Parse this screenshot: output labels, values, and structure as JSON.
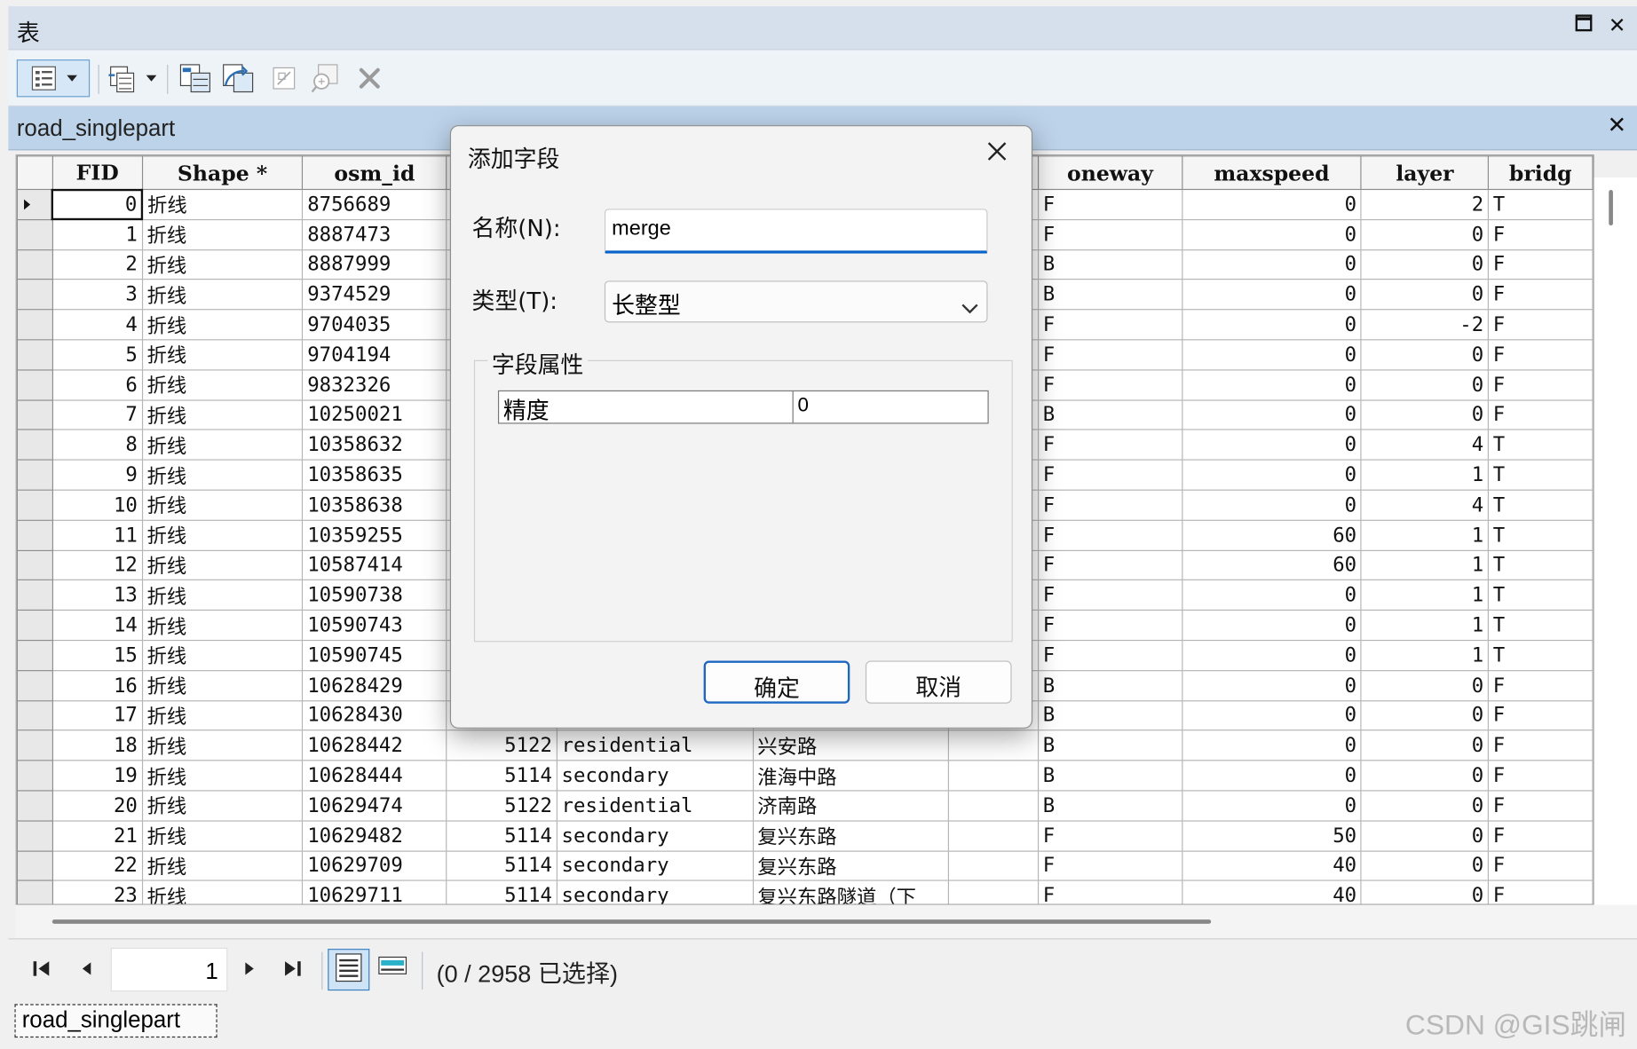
{
  "window": {
    "title": "表"
  },
  "table_tab": {
    "name": "road_singlepart"
  },
  "columns": [
    "FID",
    "Shape *",
    "osm_id",
    "",
    "",
    "",
    "",
    "oneway",
    "maxspeed",
    "layer",
    "bridg"
  ],
  "rows": [
    [
      "0",
      "折线",
      "8756689",
      "",
      "",
      "",
      "",
      "F",
      "0",
      "2",
      "T"
    ],
    [
      "1",
      "折线",
      "8887473",
      "",
      "",
      "",
      "",
      "F",
      "0",
      "0",
      "F"
    ],
    [
      "2",
      "折线",
      "8887999",
      "",
      "",
      "",
      "",
      "B",
      "0",
      "0",
      "F"
    ],
    [
      "3",
      "折线",
      "9374529",
      "",
      "",
      "",
      "",
      "B",
      "0",
      "0",
      "F"
    ],
    [
      "4",
      "折线",
      "9704035",
      "",
      "",
      "",
      "",
      "F",
      "0",
      "-2",
      "F"
    ],
    [
      "5",
      "折线",
      "9704194",
      "",
      "",
      "",
      "",
      "F",
      "0",
      "0",
      "F"
    ],
    [
      "6",
      "折线",
      "9832326",
      "",
      "",
      "",
      "",
      "F",
      "0",
      "0",
      "F"
    ],
    [
      "7",
      "折线",
      "10250021",
      "",
      "",
      "",
      "",
      "B",
      "0",
      "0",
      "F"
    ],
    [
      "8",
      "折线",
      "10358632",
      "",
      "",
      "",
      "",
      "F",
      "0",
      "4",
      "T"
    ],
    [
      "9",
      "折线",
      "10358635",
      "",
      "",
      "",
      "",
      "F",
      "0",
      "1",
      "T"
    ],
    [
      "10",
      "折线",
      "10358638",
      "",
      "",
      "",
      "",
      "F",
      "0",
      "4",
      "T"
    ],
    [
      "11",
      "折线",
      "10359255",
      "",
      "",
      "",
      "",
      "F",
      "60",
      "1",
      "T"
    ],
    [
      "12",
      "折线",
      "10587414",
      "",
      "",
      "",
      "",
      "F",
      "60",
      "1",
      "T"
    ],
    [
      "13",
      "折线",
      "10590738",
      "",
      "",
      "",
      "",
      "F",
      "0",
      "1",
      "T"
    ],
    [
      "14",
      "折线",
      "10590743",
      "",
      "",
      "",
      "",
      "F",
      "0",
      "1",
      "T"
    ],
    [
      "15",
      "折线",
      "10590745",
      "",
      "",
      "",
      "",
      "F",
      "0",
      "1",
      "T"
    ],
    [
      "16",
      "折线",
      "10628429",
      "",
      "",
      "",
      "",
      "B",
      "0",
      "0",
      "F"
    ],
    [
      "17",
      "折线",
      "10628430",
      "",
      "",
      "",
      "",
      "B",
      "0",
      "0",
      "F"
    ],
    [
      "18",
      "折线",
      "10628442",
      "5122",
      "residential",
      "兴安路",
      "",
      "B",
      "0",
      "0",
      "F"
    ],
    [
      "19",
      "折线",
      "10628444",
      "5114",
      "secondary",
      "淮海中路",
      "",
      "B",
      "0",
      "0",
      "F"
    ],
    [
      "20",
      "折线",
      "10629474",
      "5122",
      "residential",
      "济南路",
      "",
      "B",
      "0",
      "0",
      "F"
    ],
    [
      "21",
      "折线",
      "10629482",
      "5114",
      "secondary",
      "复兴东路",
      "",
      "F",
      "50",
      "0",
      "F"
    ],
    [
      "22",
      "折线",
      "10629709",
      "5114",
      "secondary",
      "复兴东路",
      "",
      "F",
      "40",
      "0",
      "F"
    ],
    [
      "23",
      "折线",
      "10629711",
      "5114",
      "secondary",
      "复兴东路隧道（下",
      "",
      "F",
      "40",
      "0",
      "F"
    ]
  ],
  "navigation": {
    "page": "1",
    "status": "(0 / 2958 已选择)"
  },
  "bottom_tab": {
    "label": "road_singlepart"
  },
  "watermark": "CSDN @GIS跳闸",
  "dialog": {
    "title": "添加字段",
    "name_label": "名称(N):",
    "name_value": "merge",
    "type_label": "类型(T):",
    "type_value": "长整型",
    "group_title": "字段属性",
    "property_name": "精度",
    "property_value": "0",
    "ok_label": "确定",
    "cancel_label": "取消"
  },
  "icons": [
    "table-options-icon",
    "dropdown-arrow-icon",
    "related-tables-icon",
    "select-by-attributes-icon",
    "switch-selection-icon",
    "clear-selection-icon",
    "zoom-to-selected-icon",
    "delete-selected-icon",
    "first-record-icon",
    "previous-record-icon",
    "next-record-icon",
    "last-record-icon",
    "show-all-records-icon",
    "show-selected-records-icon",
    "close-icon",
    "maximize-icon"
  ],
  "colors": {
    "accent": "#0a63c7",
    "title_bar": "#d5e0ec",
    "tab_bar": "#bdd3ea"
  }
}
